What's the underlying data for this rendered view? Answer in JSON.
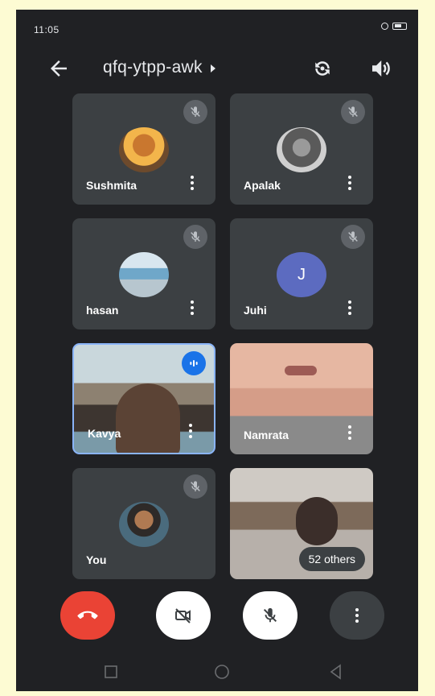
{
  "status": {
    "time": "11:05"
  },
  "meeting": {
    "title": "qfq-ytpp-awk"
  },
  "participants": [
    {
      "name": "Sushmita"
    },
    {
      "name": "Apalak"
    },
    {
      "name": "hasan"
    },
    {
      "name": "Juhi",
      "initial": "J"
    },
    {
      "name": "Kavya"
    },
    {
      "name": "Namrata"
    },
    {
      "name": "You"
    }
  ],
  "others": {
    "label": "52 others"
  },
  "colors": {
    "background": "#202124",
    "tile": "#3c4043",
    "end_call": "#ea4335",
    "active_speaker": "#8ab4f8",
    "juhi_avatar": "#5c6bc0"
  },
  "icons": {
    "back": "arrow-left-icon",
    "flip": "flip-camera-icon",
    "speaker": "speaker-icon",
    "mic_off": "mic-off-icon",
    "speaking": "speaking-icon",
    "end_call": "end-call-icon",
    "camera_off": "camera-off-icon",
    "more": "more-vert-icon"
  }
}
